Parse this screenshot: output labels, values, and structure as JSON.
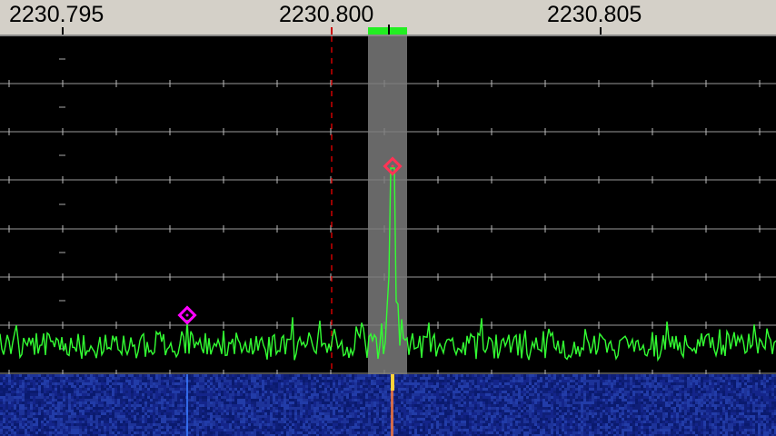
{
  "ruler": {
    "labels": [
      "2230.795",
      "2230.800",
      "2230.805"
    ]
  },
  "colors": {
    "ruler_bg": "#d4d0c8",
    "plot_bg": "#000000",
    "grid": "#9a9a9a",
    "trace": "#33ff33",
    "center_line": "#cc0000",
    "filter_passband": "#7a7a7a",
    "filter_marker": "#22ee22",
    "peak_marker_main": "#ff3355",
    "peak_marker_aux": "#ff00ff",
    "waterfall_bg": "#0a1a6e"
  }
}
